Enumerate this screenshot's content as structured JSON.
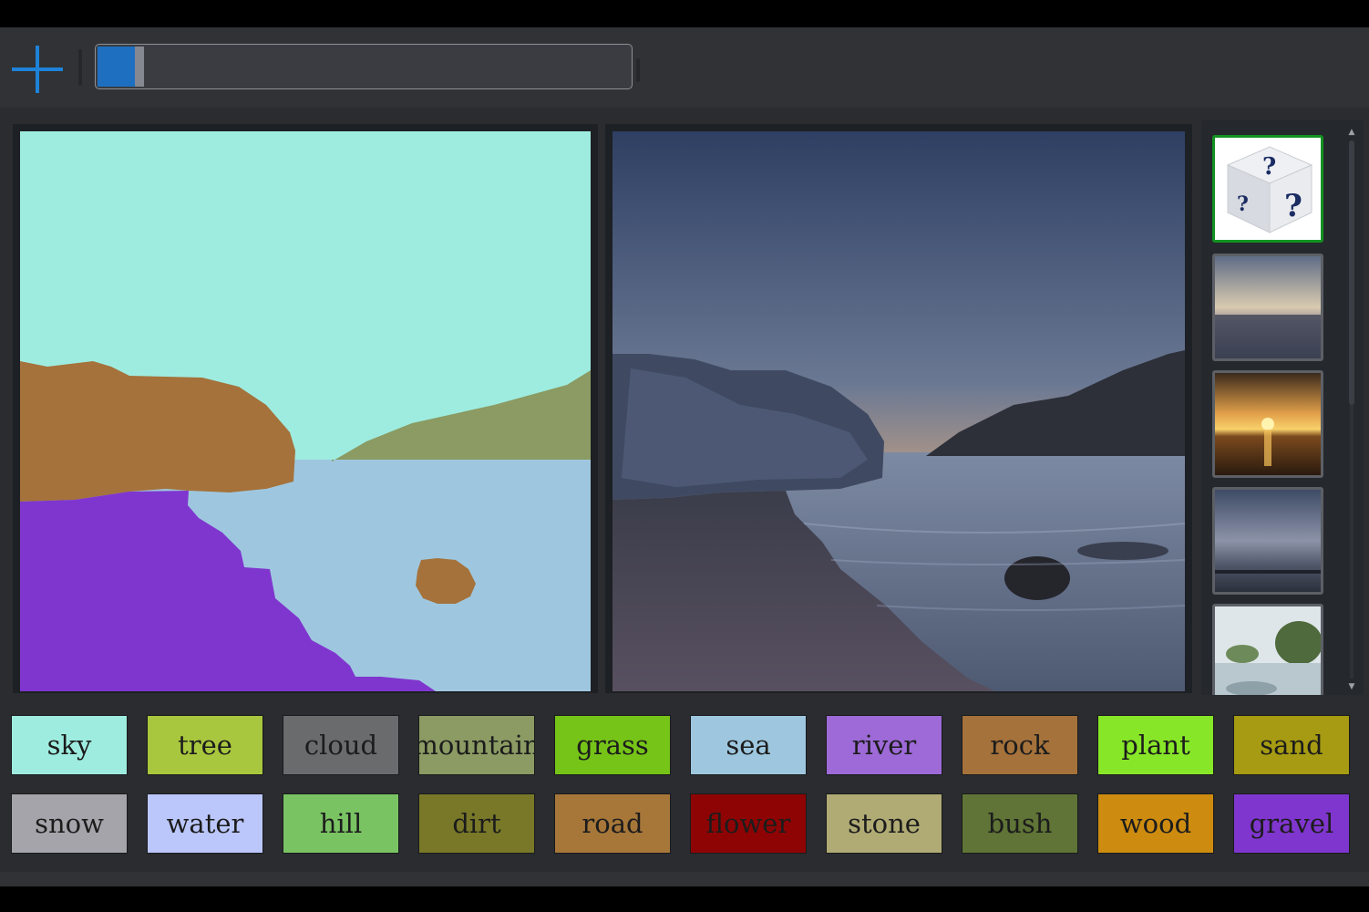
{
  "toolbar": {
    "add_icon": "plus-icon",
    "progress_percent": 8,
    "accent_color": "#1e6fc0"
  },
  "segmentation_canvas": {
    "regions": [
      "sky",
      "mountain",
      "rock",
      "sea",
      "gravel"
    ]
  },
  "output_image": {
    "description_icon": "generated-landscape-image"
  },
  "gallery": {
    "items": [
      {
        "name": "random-style-dice",
        "selected": true
      },
      {
        "name": "cloudy-city-sunset",
        "selected": false
      },
      {
        "name": "ocean-sunset",
        "selected": false
      },
      {
        "name": "dusky-sea-clouds",
        "selected": false
      },
      {
        "name": "painted-lake-trees",
        "selected": false
      }
    ]
  },
  "palette": {
    "row1": [
      {
        "label": "sky",
        "color": "#9eece0"
      },
      {
        "label": "tree",
        "color": "#a9c73e"
      },
      {
        "label": "cloud",
        "color": "#6a6b6d"
      },
      {
        "label": "mountain",
        "color": "#8b9b63"
      },
      {
        "label": "grass",
        "color": "#76c418"
      },
      {
        "label": "sea",
        "color": "#9ec7df"
      },
      {
        "label": "river",
        "color": "#9d6ad7"
      },
      {
        "label": "rock",
        "color": "#a5723b"
      },
      {
        "label": "plant",
        "color": "#88e628"
      },
      {
        "label": "sand",
        "color": "#a69b12"
      }
    ],
    "row2": [
      {
        "label": "snow",
        "color": "#a5a4aa"
      },
      {
        "label": "water",
        "color": "#bbc7fb"
      },
      {
        "label": "hill",
        "color": "#7ac363"
      },
      {
        "label": "dirt",
        "color": "#787828"
      },
      {
        "label": "road",
        "color": "#a7773a"
      },
      {
        "label": "flower",
        "color": "#8e0404"
      },
      {
        "label": "stone",
        "color": "#b0ab74"
      },
      {
        "label": "bush",
        "color": "#5f7436"
      },
      {
        "label": "wood",
        "color": "#cd8c10"
      },
      {
        "label": "gravel",
        "color": "#7f36ce"
      }
    ]
  }
}
